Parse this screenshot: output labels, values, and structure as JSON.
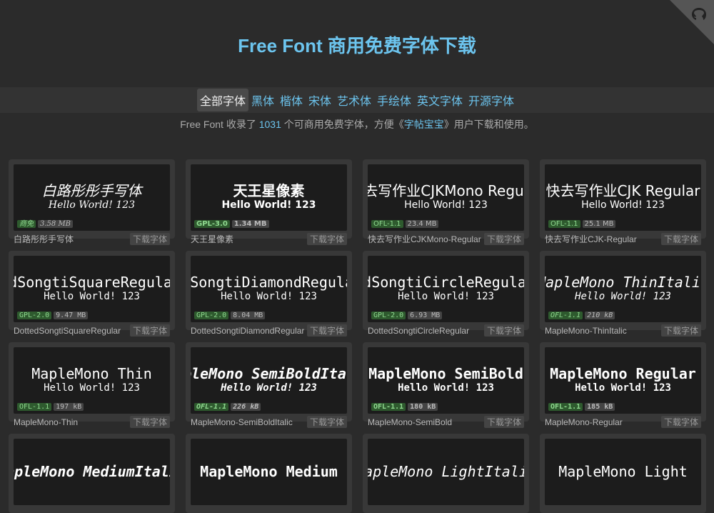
{
  "header": {
    "title": "Free Font 商用免费字体下载",
    "corner_icon": "github-icon"
  },
  "nav": {
    "items": [
      {
        "label": "全部字体",
        "active": true
      },
      {
        "label": "黑体"
      },
      {
        "label": "楷体"
      },
      {
        "label": "宋体"
      },
      {
        "label": "艺术体"
      },
      {
        "label": "手绘体"
      },
      {
        "label": "英文字体"
      },
      {
        "label": "开源字体"
      }
    ]
  },
  "intro": {
    "prefix": "Free Font 收录了",
    "count": "1031",
    "middle": "个可商用免费字体，方便《",
    "link": "字帖宝宝",
    "suffix": "》用户下载和使用。"
  },
  "colors": {
    "accent": "#6cc4ee",
    "background": "#2b2b2b",
    "card": "#383838",
    "preview": "#1c1c1c"
  },
  "download_label": "下载字体",
  "fonts": [
    {
      "preview_name": "白路彤彤手写体",
      "preview_sample": "Hello World! 123",
      "style": "brush",
      "license": "商免",
      "size": "3.58 MB",
      "name": "白路彤彤手写体"
    },
    {
      "preview_name": "天王星像素",
      "preview_sample": "Hello World! 123",
      "style": "pixel",
      "license": "GPL-3.0",
      "size": "1.34 MB",
      "name": "天王星像素"
    },
    {
      "preview_name": "快去写作业CJKMono Regular",
      "preview_sample": "Hello World! 123",
      "style": "rounded",
      "license": "OFL-1.1",
      "size": "23.4 MB",
      "name": "快去写作业CJKMono-Regular"
    },
    {
      "preview_name": "快去写作业CJK Regular",
      "preview_sample": "Hello World! 123",
      "style": "rounded",
      "license": "OFL-1.1",
      "size": "25.1 MB",
      "name": "快去写作业CJK-Regular"
    },
    {
      "preview_name": "DottedSongtiSquareRegular 字体",
      "preview_sample": "Hello World! 123",
      "style": "mono",
      "license": "GPL-2.0",
      "size": "9.47 MB",
      "name": "DottedSongtiSquareRegular"
    },
    {
      "preview_name": "DottedSongtiDiamondRegular 字体",
      "preview_sample": "Hello World! 123",
      "style": "mono",
      "license": "GPL-2.0",
      "size": "8.04 MB",
      "name": "DottedSongtiDiamondRegular"
    },
    {
      "preview_name": "DottedSongtiCircleRegular 字体",
      "preview_sample": "Hello World! 123",
      "style": "mono",
      "license": "GPL-2.0",
      "size": "6.93 MB",
      "name": "DottedSongtiCircleRegular"
    },
    {
      "preview_name": "MapleMono ThinItalic",
      "preview_sample": "Hello World! 123",
      "style": "mono-italic",
      "license": "OFL-1.1",
      "size": "210 kB",
      "name": "MapleMono-ThinItalic"
    },
    {
      "preview_name": "MapleMono Thin",
      "preview_sample": "Hello World! 123",
      "style": "mono",
      "license": "OFL-1.1",
      "size": "197 kB",
      "name": "MapleMono-Thin"
    },
    {
      "preview_name": "MapleMono SemiBoldItalic",
      "preview_sample": "Hello World! 123",
      "style": "mono-bold-italic",
      "license": "OFL-1.1",
      "size": "226 kB",
      "name": "MapleMono-SemiBoldItalic"
    },
    {
      "preview_name": "MapleMono SemiBold",
      "preview_sample": "Hello World! 123",
      "style": "mono-bold",
      "license": "OFL-1.1",
      "size": "180 kB",
      "name": "MapleMono-SemiBold"
    },
    {
      "preview_name": "MapleMono Regular",
      "preview_sample": "Hello World! 123",
      "style": "mono-bold",
      "license": "OFL-1.1",
      "size": "185 kB",
      "name": "MapleMono-Regular"
    },
    {
      "preview_name": "MapleMono MediumItalic",
      "preview_sample": "",
      "style": "mono-bold-italic",
      "license": "",
      "size": "",
      "name": ""
    },
    {
      "preview_name": "MapleMono Medium",
      "preview_sample": "",
      "style": "mono-bold",
      "license": "",
      "size": "",
      "name": ""
    },
    {
      "preview_name": "MapleMono LightItalic",
      "preview_sample": "",
      "style": "mono-italic",
      "license": "",
      "size": "",
      "name": ""
    },
    {
      "preview_name": "MapleMono Light",
      "preview_sample": "",
      "style": "mono",
      "license": "",
      "size": "",
      "name": ""
    }
  ]
}
